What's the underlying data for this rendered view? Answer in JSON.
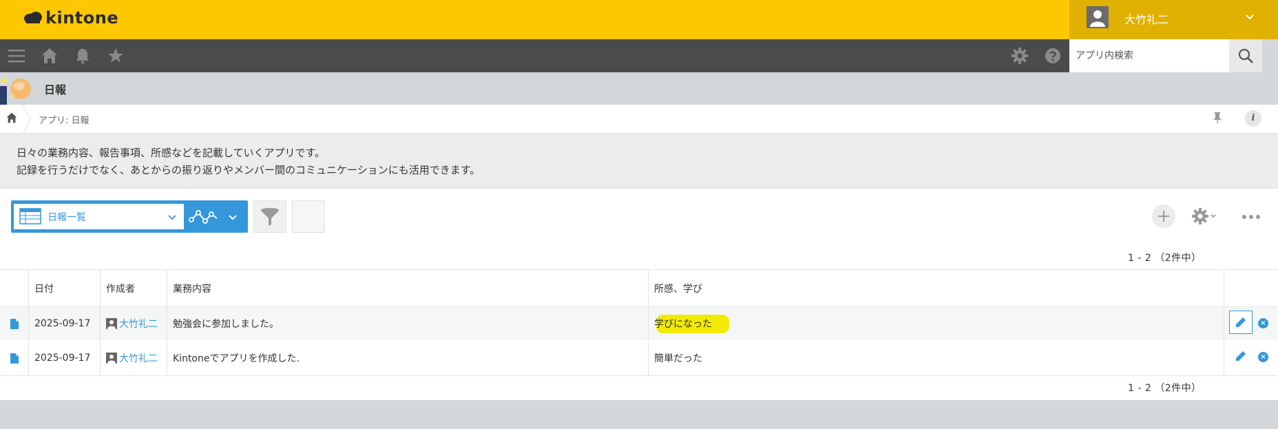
{
  "header": {
    "logo_text": "kintone",
    "user_name": "大竹礼二"
  },
  "nav": {
    "search_placeholder": "アプリ内検索"
  },
  "app": {
    "title": "日報",
    "breadcrumb": "アプリ: 日報",
    "description_line1": "日々の業務内容、報告事項、所感などを記載していくアプリです。",
    "description_line2": "記録を行うだけでなく、あとからの振り返りやメンバー間のコミュニケーションにも活用できます。"
  },
  "toolbar": {
    "view_name": "日報一覧",
    "pager_top": "1 - 2 （2件中）",
    "pager_bottom": "1 - 2 （2件中）"
  },
  "table": {
    "columns": [
      "",
      "日付",
      "作成者",
      "業務内容",
      "所感、学び",
      ""
    ],
    "rows": [
      {
        "date": "2025-09-17",
        "author": "大竹礼二",
        "work": "勉強会に参加しました。",
        "notes": "学びになった",
        "highlighted": true
      },
      {
        "date": "2025-09-17",
        "author": "大竹礼二",
        "work": "Kintoneでアプリを作成した.",
        "notes": "簡単だった",
        "highlighted": false
      }
    ]
  },
  "icons": {
    "record": "document-icon",
    "edit": "pencil-icon",
    "delete": "close-circle-icon"
  },
  "colors": {
    "header_yellow": "#fec800",
    "user_box": "#e0b100",
    "navbar": "#4b4b4b",
    "accent_blue": "#3498db",
    "highlight": "#f2ea00"
  }
}
